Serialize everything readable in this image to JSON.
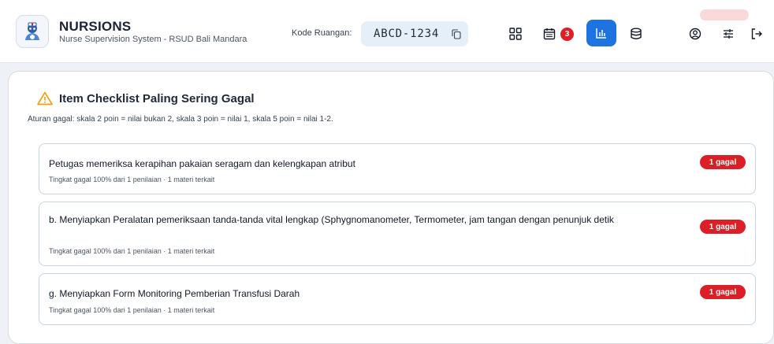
{
  "app": {
    "title": "NURSIONS",
    "subtitle": "Nurse Supervision System - RSUD Bali Mandara"
  },
  "room": {
    "label": "Kode Ruangan:",
    "code": "ABCD-1234"
  },
  "nav": {
    "icons": [
      "dashboard-grid-icon",
      "calendar-icon",
      "chart-icon",
      "database-icon",
      "user-circle-icon",
      "sliders-icon",
      "logout-icon"
    ],
    "calendar_badge": "3",
    "active": "chart-icon"
  },
  "colors": {
    "accent": "#1d73e0",
    "danger": "#dc1f26",
    "warning": "#f59e0b"
  },
  "card": {
    "title": "Item Checklist Paling Sering Gagal",
    "description": "Aturan gagal: skala 2 poin = nilai bukan 2, skala 3 poin = nilai 1, skala 5 poin = nilai 1-2.",
    "items": [
      {
        "title": "Petugas memeriksa kerapihan pakaian seragam dan kelengkapan atribut",
        "meta": "Tingkat gagal 100% dari 1 penilaian · 1 materi terkait",
        "badge": "1 gagal"
      },
      {
        "title": "b. Menyiapkan Peralatan pemeriksaan tanda-tanda vital lengkap (Sphygnomanometer, Termometer, jam tangan dengan penunjuk detik",
        "meta": "Tingkat gagal 100% dari 1 penilaian · 1 materi terkait",
        "badge": "1 gagal"
      },
      {
        "title": "g. Menyiapkan Form Monitoring Pemberian Transfusi Darah",
        "meta": "Tingkat gagal 100% dari 1 penilaian · 1 materi terkait",
        "badge": "1 gagal"
      }
    ]
  }
}
